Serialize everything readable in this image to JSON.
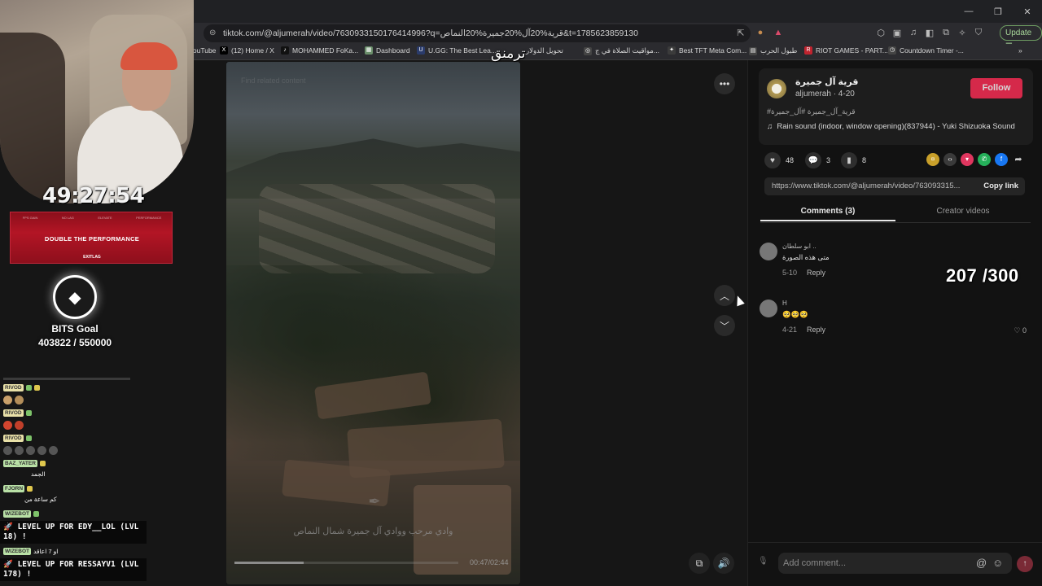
{
  "browser": {
    "url": "tiktok.com/@aljumerah/video/7630933150176414996?q=قرية%20آل%20جميرة%20النماص&t=1785623859130",
    "update_label": "Update",
    "bookmarks": [
      "YouTube",
      "(12) Home / X",
      "MOHAMMED FoKa...",
      "Dashboard",
      "U.GG: The Best Lea...",
      "تحويل الدولار",
      "مواقيت الصلاة في ج...",
      "Best TFT Meta Com...",
      "طبول الحرب",
      "RIOT GAMES - PART...",
      "Countdown Timer -..."
    ]
  },
  "video": {
    "search_hint": "Find related content",
    "caption": "وادي مرحب ووادي آل جميرة شمال النماص",
    "time": "00:47/02:44",
    "progress": 0.31
  },
  "creator": {
    "name": "قرية آل جميرة",
    "handle": "aljumerah · 4-20",
    "follow": "Follow",
    "hashtags": "#قرية_آل_جميرة #آل_جميرة",
    "sound": "Rain sound (indoor, window opening)(837944) - Yuki Shizuoka Sound"
  },
  "actions": {
    "likes": "48",
    "comments": "3",
    "saves": "8"
  },
  "share_link": {
    "url": "https://www.tiktok.com/@aljumerah/video/763093315...",
    "copy": "Copy link"
  },
  "tabs": {
    "comments": "Comments (3)",
    "creator_videos": "Creator videos"
  },
  "comments": [
    {
      "user": "ابو سلطان ..",
      "text": "متى هذه الصورة",
      "date": "5-10",
      "reply": "Reply"
    },
    {
      "user": "H",
      "text": "🥺🥺🥺",
      "date": "4-21",
      "reply": "Reply",
      "likes": "0"
    }
  ],
  "comment_input": {
    "placeholder": "Add comment..."
  },
  "stream": {
    "timer": "49:27:54",
    "banner_top": [
      "FPS GAIN",
      "NO LAG",
      "ELEVATE",
      "PERFORMANCE"
    ],
    "banner_title": "DOUBLE THE PERFORMANCE",
    "banner_brand": "EXITLAG",
    "bits_label": "BITS Goal",
    "bits_value": "403822 / 550000",
    "center_text": "ترمنق",
    "counter": "207 /300",
    "chat": {
      "user1": "RIVOD",
      "user2": "RIVOD",
      "user3": "RIVOD",
      "user4": "BAZ_YATER",
      "msg4": "الجمد",
      "user5": "FJORN",
      "msg5": "كم ساعة من",
      "user6": "WIZEBOT",
      "levelup1": "LEVEL UP FOR EDY__LOL (LVL 18) !",
      "user7": "WIZEBOT",
      "msg7": "او 7 اعاقد",
      "levelup2": "LEVEL UP FOR RESSAYV1 (LVL 178) !"
    }
  }
}
